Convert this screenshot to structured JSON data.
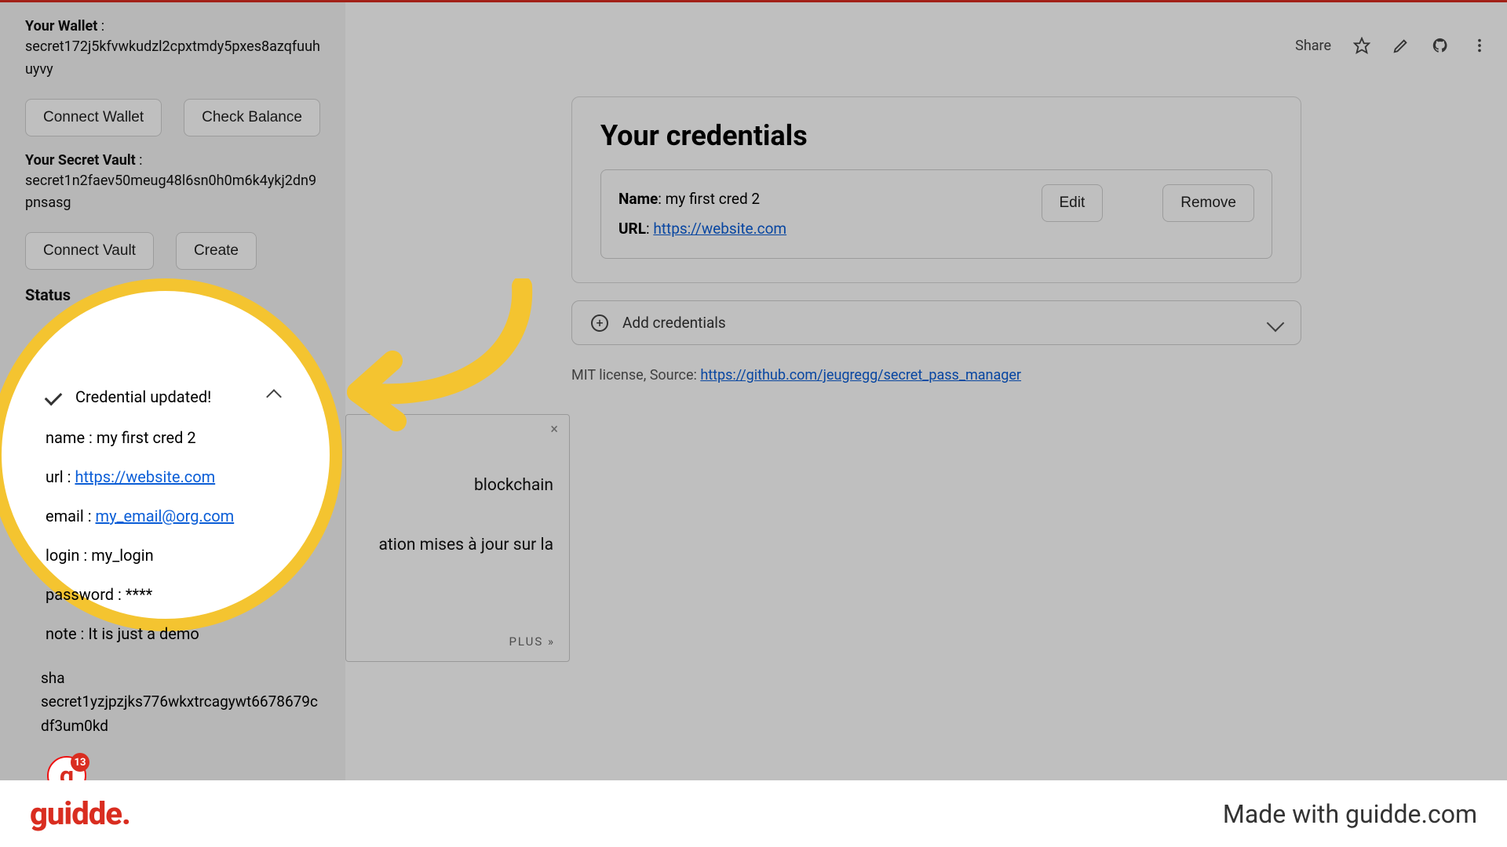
{
  "sidebar": {
    "wallet_label": "Your Wallet",
    "wallet_addr": "secret172j5kfvwkudzl2cpxtmdy5pxes8azqfuuhuyvy",
    "connect_wallet": "Connect Wallet",
    "check_balance": "Check Balance",
    "vault_label": "Your Secret Vault",
    "vault_addr": "secret1n2faev50meug48l6sn0h0m6k4ykj2dn9pnsasg",
    "connect_vault": "Connect Vault",
    "create": "Create",
    "status_label": "Status",
    "shared": "sha",
    "shared_addr": "secret1yzjpzjks776wkxtrcagywt6678679cdf3um0kd"
  },
  "spotlight": {
    "header": "Credential updated!",
    "name_key": "name :",
    "name_val": "my first cred 2",
    "url_key": "url :",
    "url_val": "https://website.com",
    "email_key": "email :",
    "email_val": "my_email@org.com",
    "login_key": "login :",
    "login_val": "my_login",
    "password_key": "password :",
    "password_val": "****",
    "note_key": "note :",
    "note_val": "It is just a demo"
  },
  "toolbar": {
    "share": "Share"
  },
  "main": {
    "title": "Your credentials",
    "cred_name_key": "Name",
    "cred_name_val": "my first cred 2",
    "cred_url_key": "URL",
    "cred_url_val": "https://website.com",
    "edit": "Edit",
    "remove": "Remove",
    "add_label": "Add credentials",
    "license_prefix": "MIT license, Source: ",
    "license_url": "https://github.com/jeugregg/secret_pass_manager"
  },
  "popup": {
    "line1": "blockchain",
    "line2": "ation mises à jour sur la",
    "plus": "PLUS »"
  },
  "avatar": {
    "badge": "13"
  },
  "footer": {
    "brand": "guidde",
    "made": "Made with guidde.com"
  }
}
